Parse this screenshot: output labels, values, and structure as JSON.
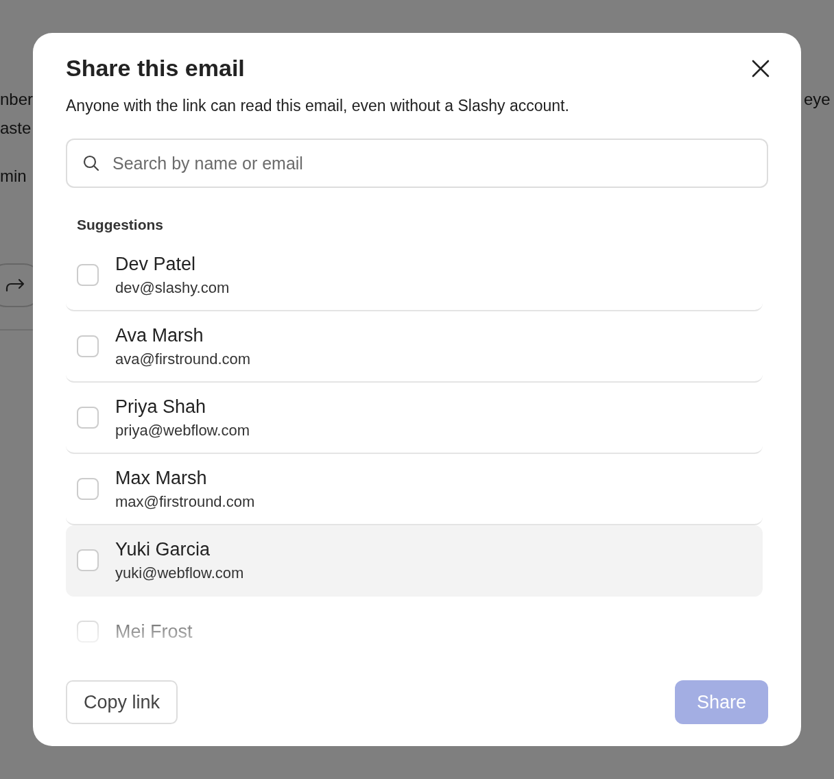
{
  "background": {
    "left_fragments": [
      "nber",
      "aste",
      "min"
    ],
    "right_fragments": [
      "eye"
    ]
  },
  "dialog": {
    "title": "Share this email",
    "description": "Anyone with the link can read this email, even without a Slashy account.",
    "search": {
      "placeholder": "Search by name or email"
    },
    "suggestions_label": "Suggestions",
    "people": [
      {
        "name": "Dev Patel",
        "email": "dev@slashy.com",
        "checked": false,
        "highlighted": false
      },
      {
        "name": "Ava Marsh",
        "email": "ava@firstround.com",
        "checked": false,
        "highlighted": false
      },
      {
        "name": "Priya Shah",
        "email": "priya@webflow.com",
        "checked": false,
        "highlighted": false
      },
      {
        "name": "Max Marsh",
        "email": "max@firstround.com",
        "checked": false,
        "highlighted": false
      },
      {
        "name": "Yuki Garcia",
        "email": "yuki@webflow.com",
        "checked": false,
        "highlighted": true
      },
      {
        "name": "Mei Frost",
        "checked": false,
        "highlighted": false
      }
    ],
    "copy_link": "Copy link",
    "share": {
      "label": "Share",
      "disabled": true
    }
  }
}
